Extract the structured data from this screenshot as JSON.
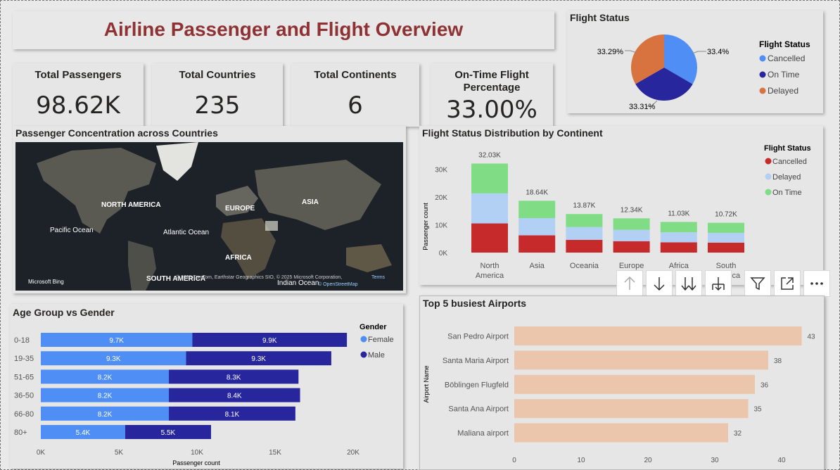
{
  "title": "Airline Passenger and Flight Overview",
  "kpis": {
    "passengers": {
      "label": "Total Passengers",
      "value": "98.62K"
    },
    "countries": {
      "label": "Total Countries",
      "value": "235"
    },
    "continents": {
      "label": "Total Continents",
      "value": "6"
    },
    "ontime": {
      "label": "On-Time Flight Percentage",
      "value": "33.00%"
    }
  },
  "flight_status": {
    "title": "Flight Status",
    "legend_title": "Flight Status",
    "labels": {
      "cancelled": "33.4%",
      "ontime": "33.31%",
      "delayed": "33.29%"
    }
  },
  "map": {
    "title": "Passenger Concentration across Countries",
    "labels": {
      "na": "NORTH AMERICA",
      "eu": "EUROPE",
      "asia": "ASIA",
      "pacific": "Pacific Ocean",
      "atlantic": "Atlantic Ocean",
      "africa": "AFRICA",
      "sa": "SOUTH AMERICA",
      "indian": "Indian Ocean"
    },
    "bing": "Microsoft Bing",
    "attribution": "© 2025 TomTom, Earthstar Geographics SIO, © 2025 Microsoft Corporation,",
    "terms": "Terms",
    "osm": "© OpenStreetMap"
  },
  "continent_chart": {
    "title": "Flight Status Distribution by Continent",
    "ylabel": "Passenger count",
    "legend_title": "Flight Status",
    "yticks": [
      "0K",
      "10K",
      "20K",
      "30K"
    ],
    "total_labels": [
      "32.03K",
      "18.64K",
      "13.87K",
      "12.34K",
      "11.03K",
      "10.72K"
    ]
  },
  "age_chart": {
    "title": "Age Group vs Gender",
    "xlabel": "Passenger count",
    "legend_title": "Gender",
    "xticks": [
      "0K",
      "5K",
      "10K",
      "15K",
      "20K"
    ],
    "female_labels": [
      "9.7K",
      "9.3K",
      "8.2K",
      "8.2K",
      "8.2K",
      "5.4K"
    ],
    "male_labels": [
      "9.9K",
      "9.3K",
      "8.3K",
      "8.4K",
      "8.1K",
      "5.5K"
    ]
  },
  "airport_chart": {
    "title": "Top 5 busiest Airports",
    "ylabel": "Airport Name",
    "xticks": [
      "0",
      "10",
      "20",
      "30",
      "40"
    ]
  },
  "colors": {
    "cancelled": "#c62a2a",
    "delayed": "#b2cff4",
    "ontime": "#80dd85",
    "pie_cancelled": "#4f8ef5",
    "pie_ontime": "#27269d",
    "pie_delayed": "#d8733f",
    "female": "#4f8ef5",
    "male": "#27269d",
    "airport": "#ecc5ad",
    "title": "#8f3234"
  },
  "chart_data": [
    {
      "type": "pie",
      "title": "Flight Status",
      "categories": [
        "Cancelled",
        "On Time",
        "Delayed"
      ],
      "values": [
        33.4,
        33.31,
        33.29
      ],
      "legend": "right"
    },
    {
      "type": "bar",
      "title": "Flight Status Distribution by Continent",
      "categories": [
        "North America",
        "Asia",
        "Oceania",
        "Europe",
        "Africa",
        "South America"
      ],
      "series": [
        {
          "name": "Cancelled",
          "values": [
            10.5,
            6.2,
            4.6,
            4.1,
            3.7,
            3.6
          ]
        },
        {
          "name": "Delayed",
          "values": [
            10.8,
            6.2,
            4.6,
            4.1,
            3.6,
            3.5
          ]
        },
        {
          "name": "On Time",
          "values": [
            10.73,
            6.24,
            4.67,
            4.14,
            3.73,
            3.62
          ]
        }
      ],
      "totals": [
        32.03,
        18.64,
        13.87,
        12.34,
        11.03,
        10.72
      ],
      "ylabel": "Passenger count",
      "ylim": [
        0,
        35
      ],
      "legend": "top-right",
      "stacked": true
    },
    {
      "type": "bar",
      "title": "Age Group vs Gender",
      "orientation": "horizontal",
      "categories": [
        "0-18",
        "19-35",
        "51-65",
        "36-50",
        "66-80",
        "80+"
      ],
      "series": [
        {
          "name": "Female",
          "values": [
            9.7,
            9.3,
            8.2,
            8.2,
            8.2,
            5.4
          ]
        },
        {
          "name": "Male",
          "values": [
            9.9,
            9.3,
            8.3,
            8.4,
            8.1,
            5.5
          ]
        }
      ],
      "xlabel": "Passenger count",
      "xlim": [
        0,
        20
      ],
      "legend": "top-right",
      "stacked": true
    },
    {
      "type": "bar",
      "title": "Top 5 busiest Airports",
      "orientation": "horizontal",
      "categories": [
        "San Pedro Airport",
        "Santa Maria Airport",
        "Böblingen Flugfeld",
        "Santa Ana Airport",
        "Maliana airport"
      ],
      "values": [
        43,
        38,
        36,
        35,
        32
      ],
      "ylabel": "Airport Name",
      "xlim": [
        0,
        45
      ]
    }
  ]
}
